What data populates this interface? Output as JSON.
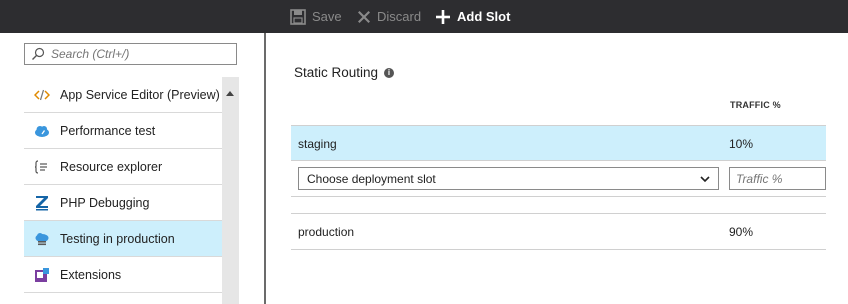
{
  "toolbar": {
    "save_label": "Save",
    "discard_label": "Discard",
    "add_slot_label": "Add Slot"
  },
  "sidebar": {
    "search_placeholder": "Search (Ctrl+/)",
    "items": [
      {
        "label": "App Service Editor (Preview)",
        "icon": "code-icon"
      },
      {
        "label": "Performance test",
        "icon": "cloud-gauge-icon"
      },
      {
        "label": "Resource explorer",
        "icon": "resource-explorer-icon"
      },
      {
        "label": "PHP Debugging",
        "icon": "zend-icon"
      },
      {
        "label": "Testing in production",
        "icon": "testing-in-production-icon",
        "selected": true
      },
      {
        "label": "Extensions",
        "icon": "extensions-icon"
      }
    ]
  },
  "main": {
    "title": "Static Routing",
    "traffic_header": "TRAFFIC %",
    "rows": [
      {
        "name": "staging",
        "traffic": "10%"
      },
      {
        "name": "production",
        "traffic": "90%"
      }
    ],
    "slot_select_value": "Choose deployment slot",
    "traffic_placeholder": "Traffic %"
  },
  "colors": {
    "topbar": "#2d2d30",
    "selected_bg": "#cdeffc",
    "azure_blue": "#2f8fd1"
  }
}
